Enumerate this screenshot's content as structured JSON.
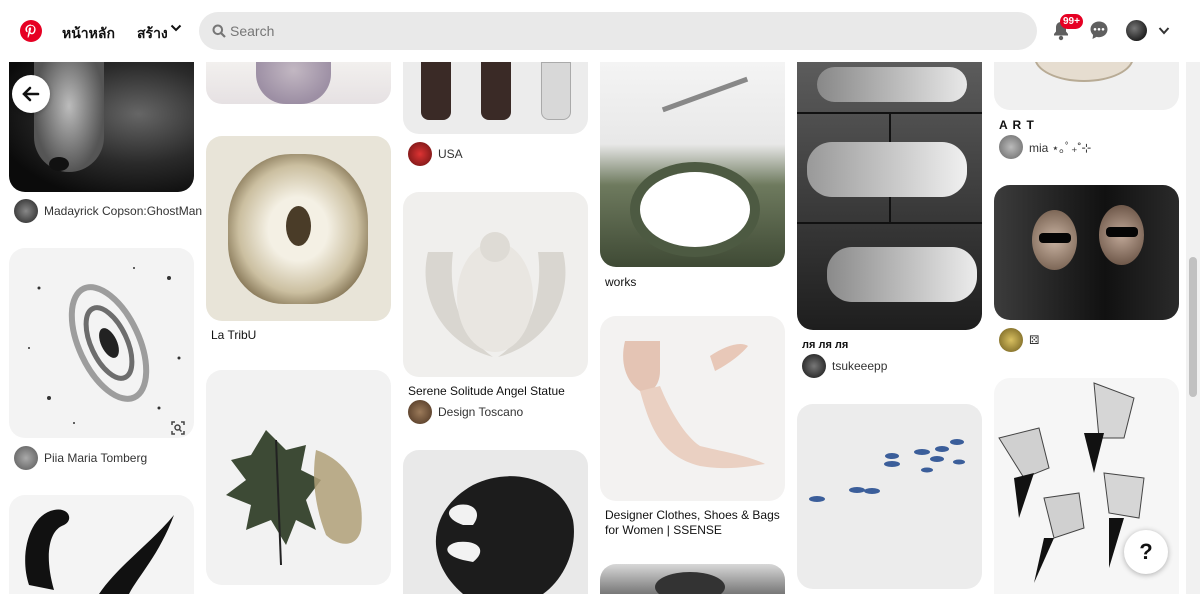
{
  "header": {
    "home_label": "หน้าหลัก",
    "create_label": "สร้าง",
    "search_placeholder": "Search",
    "notification_count": "99+"
  },
  "colors": {
    "brand": "#e60023",
    "search_bg": "#e9e9e9"
  },
  "pins": {
    "col1": {
      "pin1_user": "Madayrick Copson:GhostMan",
      "pin2_user": "Piia Maria Tomberg"
    },
    "col2": {
      "pin2_title": "La TribU"
    },
    "col3": {
      "pin1_user": "USA",
      "pin2_title": "Serene Solitude Angel Statue",
      "pin2_user": "Design Toscano"
    },
    "col4": {
      "pin1_title": "works",
      "pin2_title": "Designer Clothes, Shoes & Bags for Women | SSENSE"
    },
    "col5": {
      "pin1_title": "ля ля ля",
      "pin1_user": "tsukeeepp"
    },
    "col6": {
      "pin1_title": "A R T",
      "pin1_user": "mia ⋆｡ﾟ₊˚⊹",
      "pin2_user": "⚄"
    }
  },
  "help_label": "?"
}
